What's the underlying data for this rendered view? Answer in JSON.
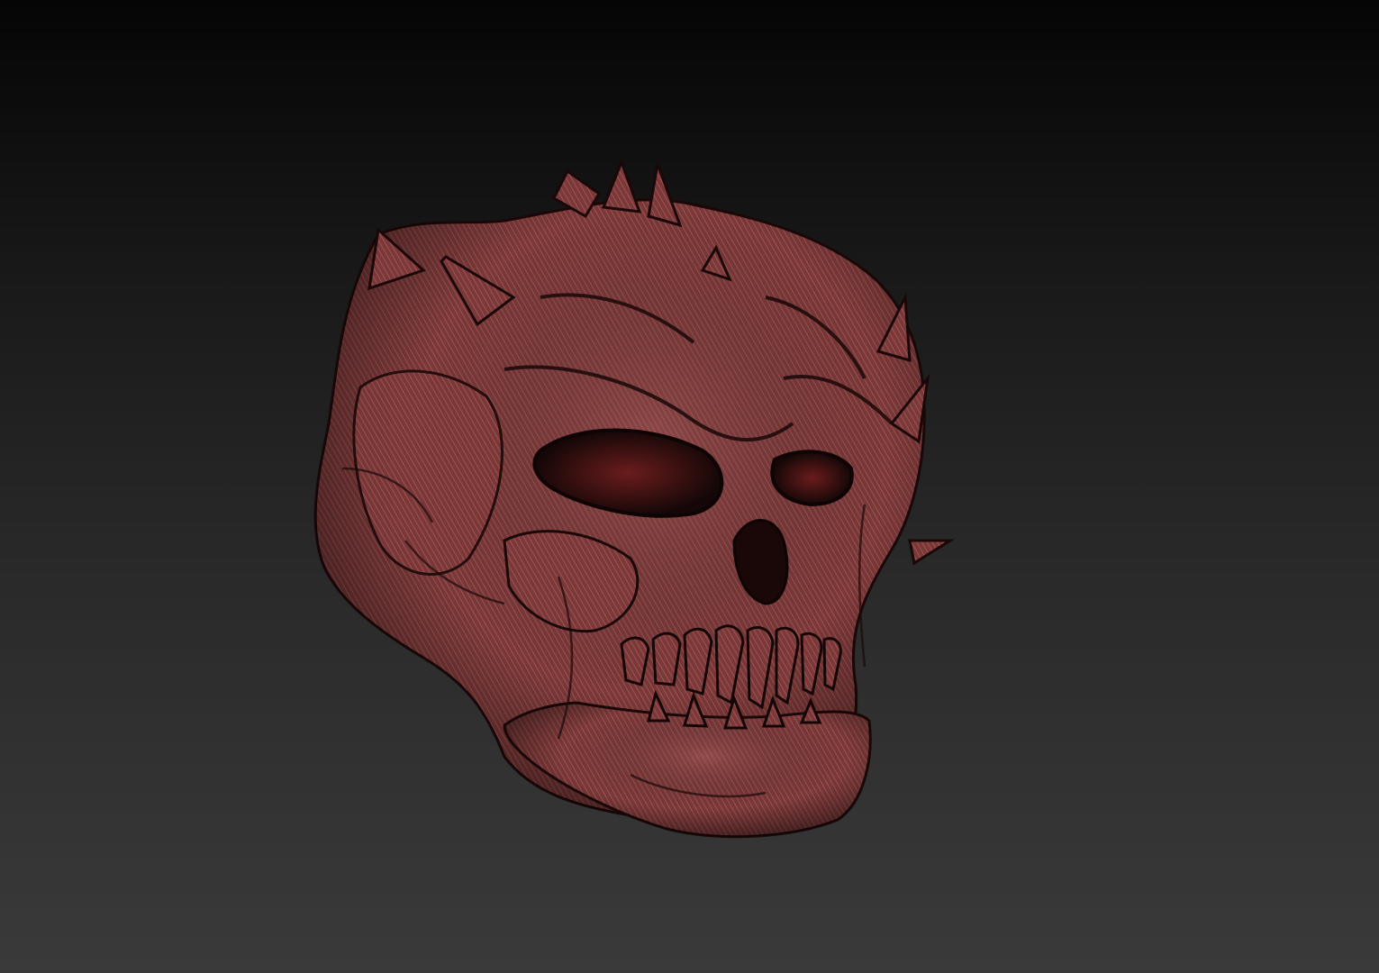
{
  "viewport": {
    "background_top": "#050505",
    "background_bottom": "#3a3a3a"
  },
  "model": {
    "subject": "demon-skull",
    "material_color": "#8a3f3f",
    "shadow_color": "#1e0c0c",
    "highlight_color": "#b46a6a"
  }
}
